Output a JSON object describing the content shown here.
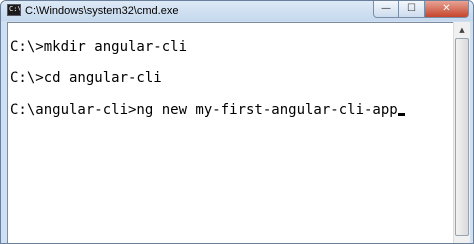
{
  "window": {
    "title": "C:\\Windows\\system32\\cmd.exe",
    "icon_text": "C:\\",
    "buttons": {
      "minimize": "—",
      "maximize": "☐",
      "close": "✕"
    }
  },
  "console": {
    "lines": [
      "C:\\>mkdir angular-cli",
      "C:\\>cd angular-cli",
      "C:\\angular-cli>ng new my-first-angular-cli-app"
    ]
  },
  "scrollbar": {
    "up_arrow": "▲"
  },
  "colors": {
    "console_background": "#ffffff",
    "console_text": "#000000",
    "close_button": "#c4452c"
  },
  "icons": [
    "console-app-icon",
    "minimize-icon",
    "maximize-icon",
    "close-icon",
    "scroll-up-icon"
  ]
}
